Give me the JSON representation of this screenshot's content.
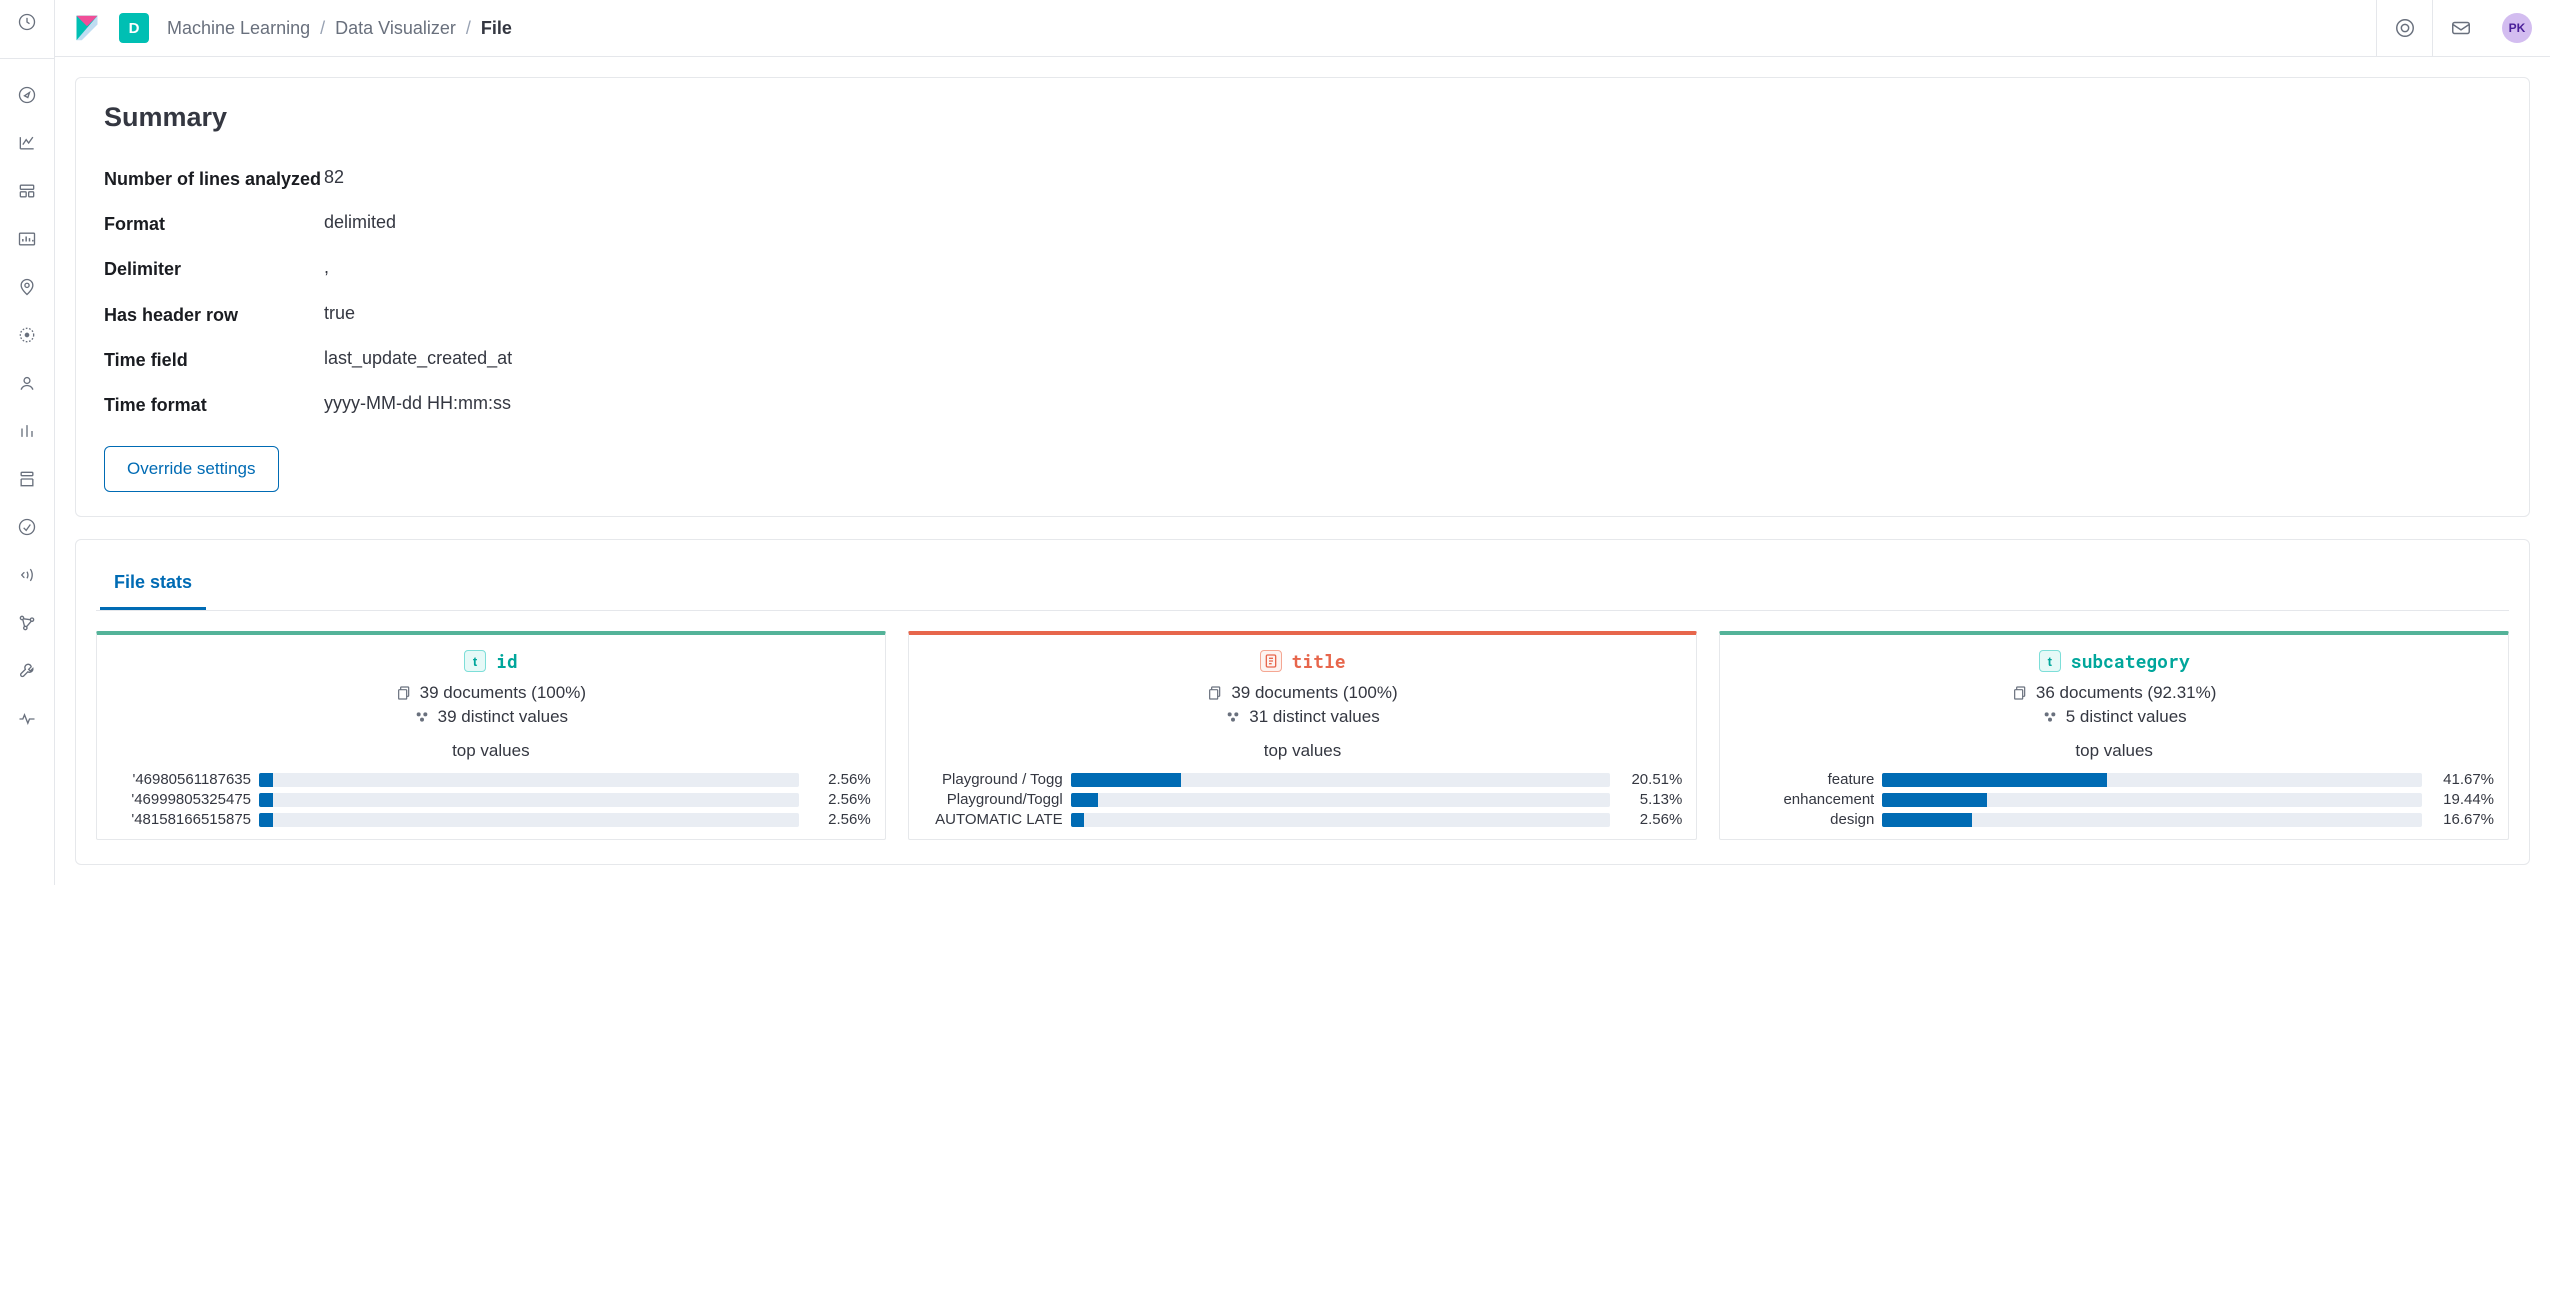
{
  "app_letter": "D",
  "breadcrumb": {
    "a": "Machine Learning",
    "b": "Data Visualizer",
    "c": "File"
  },
  "avatar_initials": "PK",
  "summary": {
    "title": "Summary",
    "rows": [
      {
        "label": "Number of lines analyzed",
        "value": "82"
      },
      {
        "label": "Format",
        "value": "delimited"
      },
      {
        "label": "Delimiter",
        "value": ","
      },
      {
        "label": "Has header row",
        "value": "true"
      },
      {
        "label": "Time field",
        "value": "last_update_created_at"
      },
      {
        "label": "Time format",
        "value": "yyyy-MM-dd HH:mm:ss"
      }
    ],
    "override_btn": "Override settings"
  },
  "stats_tab": "File stats",
  "top_values_label": "top values",
  "cards": [
    {
      "accent": "green",
      "token": "t",
      "name": "id",
      "docs": "39 documents (100%)",
      "distinct": "39 distinct values",
      "values": [
        {
          "label": "'46980561187635",
          "pct": "2.56%",
          "w": 2.56
        },
        {
          "label": "'46999805325475",
          "pct": "2.56%",
          "w": 2.56
        },
        {
          "label": "'48158166515875",
          "pct": "2.56%",
          "w": 2.56
        }
      ]
    },
    {
      "accent": "orange",
      "token": "doc",
      "name": "title",
      "docs": "39 documents (100%)",
      "distinct": "31 distinct values",
      "values": [
        {
          "label": "Playground / Togg",
          "pct": "20.51%",
          "w": 20.51
        },
        {
          "label": "Playground/Toggl",
          "pct": "5.13%",
          "w": 5.13
        },
        {
          "label": "AUTOMATIC LATE",
          "pct": "2.56%",
          "w": 2.56
        }
      ]
    },
    {
      "accent": "green",
      "token": "t",
      "name": "subcategory",
      "docs": "36 documents (92.31%)",
      "distinct": "5 distinct values",
      "values": [
        {
          "label": "feature",
          "pct": "41.67%",
          "w": 41.67
        },
        {
          "label": "enhancement",
          "pct": "19.44%",
          "w": 19.44
        },
        {
          "label": "design",
          "pct": "16.67%",
          "w": 16.67
        }
      ]
    }
  ]
}
